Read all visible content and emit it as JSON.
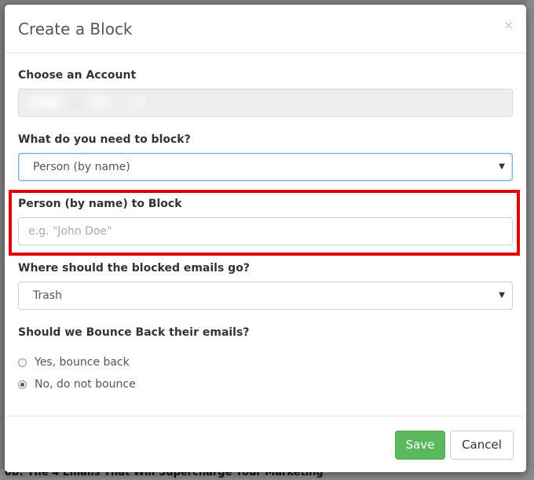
{
  "background": {
    "bottom_text": "ob! The 4 Emails That Will Supercharge Your Marketing"
  },
  "modal": {
    "title": "Create a Block",
    "close_label": "×",
    "account": {
      "label": "Choose an Account"
    },
    "block_type": {
      "label": "What do you need to block?",
      "selected": "Person (by name)"
    },
    "person": {
      "label": "Person (by name) to Block",
      "placeholder": "e.g. \"John Doe\""
    },
    "destination": {
      "label": "Where should the blocked emails go?",
      "selected": "Trash"
    },
    "bounce": {
      "label": "Should we Bounce Back their emails?",
      "options": [
        {
          "label": "Yes, bounce back",
          "checked": false
        },
        {
          "label": "No, do not bounce",
          "checked": true
        }
      ]
    },
    "footer": {
      "save_label": "Save",
      "cancel_label": "Cancel"
    }
  },
  "colors": {
    "save_button": "#5cb85c",
    "highlight": "#e00000",
    "focus_border": "#66afe9"
  }
}
